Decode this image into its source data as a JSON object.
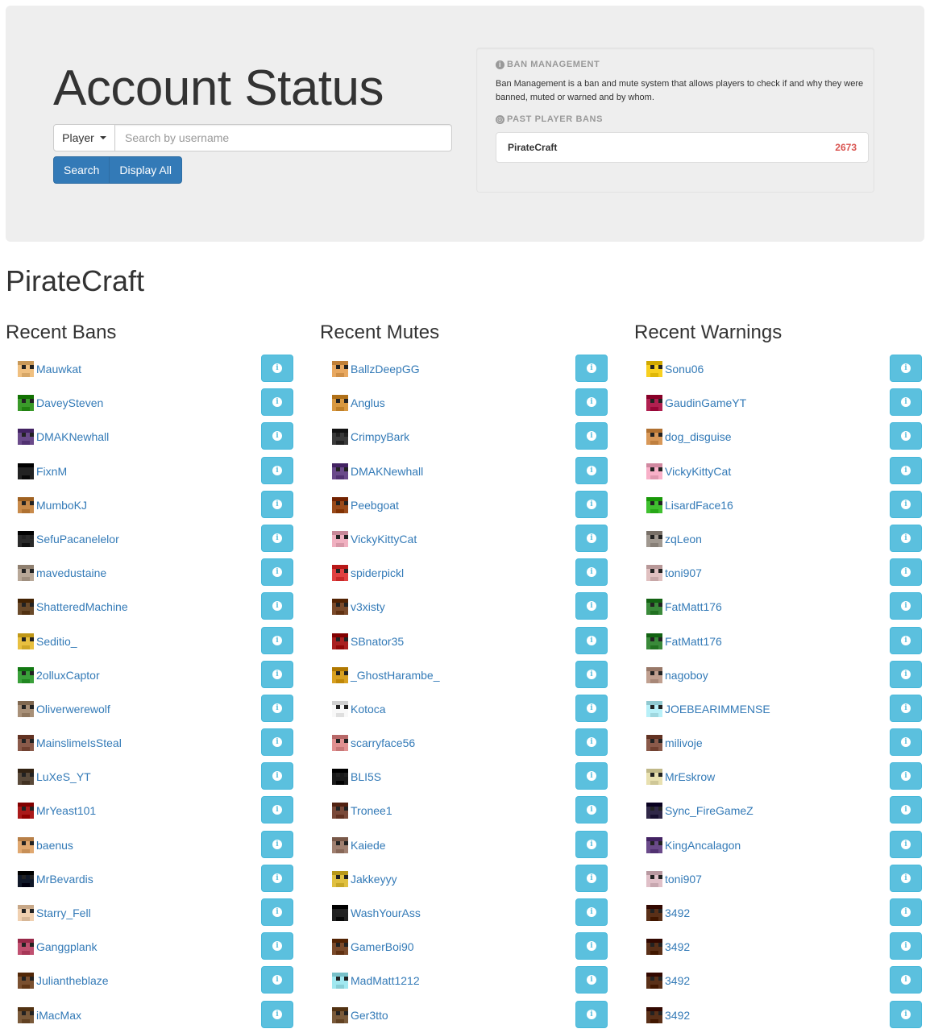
{
  "header": {
    "title": "Account Status",
    "dropdown_label": "Player",
    "search_placeholder": "Search by username",
    "search_button": "Search",
    "display_all_button": "Display All"
  },
  "sidebar": {
    "ban_management_heading": "BAN MANAGEMENT",
    "ban_management_description": "Ban Management is a ban and mute system that allows players to check if and why they were banned, muted or warned and by whom.",
    "past_bans_heading": "PAST PLAYER BANS",
    "servers": [
      {
        "name": "PirateCraft",
        "count": "2673"
      }
    ]
  },
  "server_name": "PirateCraft",
  "colors": {
    "primary": "#337ab7",
    "info": "#5bc0de",
    "danger": "#d9534f",
    "jumbotron_bg": "#eeeeee"
  },
  "columns": [
    {
      "title": "Recent Bans",
      "players": [
        "Mauwkat",
        "DaveySteven",
        "DMAKNewhall",
        "FixnM",
        "MumboKJ",
        "SefuPacanelelor",
        "mavedustaine",
        "ShatteredMachine",
        "Seditio_",
        "2olluxCaptor",
        "Oliverwerewolf",
        "MainslimeIsSteal",
        "LuXeS_YT",
        "MrYeast101",
        "baenus",
        "MrBevardis",
        "Starry_Fell",
        "Ganggplank",
        "Juliantheblaze",
        "iMacMax"
      ],
      "avatars": [
        "#f0c080",
        "#3a9a2a",
        "#6a4a8a",
        "#222222",
        "#c88a4a",
        "#2a2a2a",
        "#b8a898",
        "#6a4a2a",
        "#e8c040",
        "#3aa03a",
        "#a89078",
        "#8a5a4a",
        "#5a4a3a",
        "#aa1a1a",
        "#e0a870",
        "#101828",
        "#f0d0b0",
        "#c05070",
        "#7a5030",
        "#7a5a3a"
      ]
    },
    {
      "title": "Recent Mutes",
      "players": [
        "BallzDeepGG",
        "Anglus",
        "CrimpyBark",
        "DMAKNewhall",
        "Peebgoat",
        "VickyKittyCat",
        "spiderpickl",
        "v3xisty",
        "SBnator35",
        "_GhostHarambe_",
        "Kotoca",
        "scarryface56",
        "BLI5S",
        "Tronee1",
        "Kaiede",
        "Jakkeyyy",
        "WashYourAss",
        "GamerBoi90",
        "MadMatt1212",
        "Ger3tto"
      ],
      "avatars": [
        "#e8a860",
        "#d89840",
        "#3a3a3a",
        "#6a4a8a",
        "#9a4a1a",
        "#f0b0c0",
        "#e04040",
        "#7a4a2a",
        "#aa2020",
        "#d8a020",
        "#f8f8f8",
        "#e09090",
        "#1a1a1a",
        "#7a4a3a",
        "#a08070",
        "#e0c040",
        "#202020",
        "#7a4a2a",
        "#a0e8f0",
        "#7a5a3a"
      ]
    },
    {
      "title": "Recent Warnings",
      "players": [
        "Sonu06",
        "GaudinGameYT",
        "dog_disguise",
        "VickyKittyCat",
        "LisardFace16",
        "zqLeon",
        "toni907",
        "FatMatt176",
        "FatMatt176",
        "nagoboy",
        "JOEBEARIMMENSE",
        "milivoje",
        "MrEskrow",
        "Sync_FireGameZ",
        "KingAncalagon",
        "toni907",
        "3492",
        "3492",
        "3492",
        "3492"
      ],
      "avatars": [
        "#f8d020",
        "#b02050",
        "#d89858",
        "#f8b0c8",
        "#40c030",
        "#a09890",
        "#e0c0c0",
        "#3a8a3a",
        "#3a8a3a",
        "#c0a090",
        "#b8f0f8",
        "#8a5a4a",
        "#e8e0b0",
        "#302848",
        "#6a4a8a",
        "#e0c0c8",
        "#5a3018",
        "#5a3018",
        "#5a3018",
        "#5a3018"
      ]
    }
  ]
}
